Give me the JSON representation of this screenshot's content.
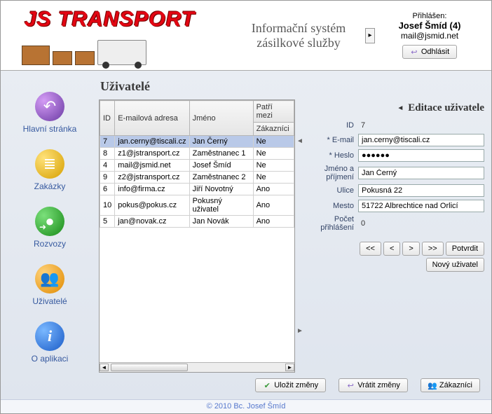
{
  "header": {
    "logo_text": "JS TRANSPORT",
    "system_line1": "Informační systém",
    "system_line2": "zásilkové služby",
    "logged_in_label": "Přihlášen:",
    "user_name": "Josef Šmíd (4)",
    "user_mail": "mail@jsmid.net",
    "logout_label": "Odhlásit"
  },
  "sidebar": {
    "items": [
      {
        "label": "Hlavní stránka"
      },
      {
        "label": "Zakázky"
      },
      {
        "label": "Rozvozy"
      },
      {
        "label": "Uživatelé"
      },
      {
        "label": "O aplikaci"
      }
    ]
  },
  "page": {
    "title": "Uživatelé"
  },
  "grid": {
    "columns": {
      "id": "ID",
      "email": "E-mailová adresa",
      "name": "Jméno",
      "group_top": "Patří mezi",
      "group_bottom": "Zákazníci"
    },
    "rows": [
      {
        "id": "7",
        "email": "jan.cerny@tiscali.cz",
        "name": "Jan Černý",
        "cust": "Ne",
        "selected": true
      },
      {
        "id": "8",
        "email": "z1@jstransport.cz",
        "name": "Zaměstnanec 1",
        "cust": "Ne"
      },
      {
        "id": "4",
        "email": "mail@jsmid.net",
        "name": "Josef Šmíd",
        "cust": "Ne"
      },
      {
        "id": "9",
        "email": "z2@jstransport.cz",
        "name": "Zaměstnanec 2",
        "cust": "Ne"
      },
      {
        "id": "6",
        "email": "info@firma.cz",
        "name": "Jiří Novotný",
        "cust": "Ano"
      },
      {
        "id": "10",
        "email": "pokus@pokus.cz",
        "name": "Pokusný uživatel",
        "cust": "Ano"
      },
      {
        "id": "5",
        "email": "jan@novak.cz",
        "name": "Jan Novák",
        "cust": "Ano"
      }
    ]
  },
  "form": {
    "title": "Editace uživatele",
    "labels": {
      "id": "ID",
      "email": "E-mail",
      "password": "Heslo",
      "name": "Jméno a příjmení",
      "street": "Ulice",
      "city": "Mesto",
      "logins": "Počet přihlášení"
    },
    "values": {
      "id": "7",
      "email": "jan.cerny@tiscali.cz",
      "password": "●●●●●●",
      "name": "Jan Černý",
      "street": "Pokusná 22",
      "city": "51722 Albrechtice nad Orlicí",
      "logins": "0"
    },
    "nav": {
      "first": "<<",
      "prev": "<",
      "next": ">",
      "last": ">>",
      "confirm": "Potvrdit",
      "new": "Nový uživatel"
    }
  },
  "actions": {
    "save": "Uložit změny",
    "revert": "Vrátit změny",
    "customers": "Zákazníci"
  },
  "footer": {
    "text": "© 2010 Bc. Josef Šmíd"
  }
}
